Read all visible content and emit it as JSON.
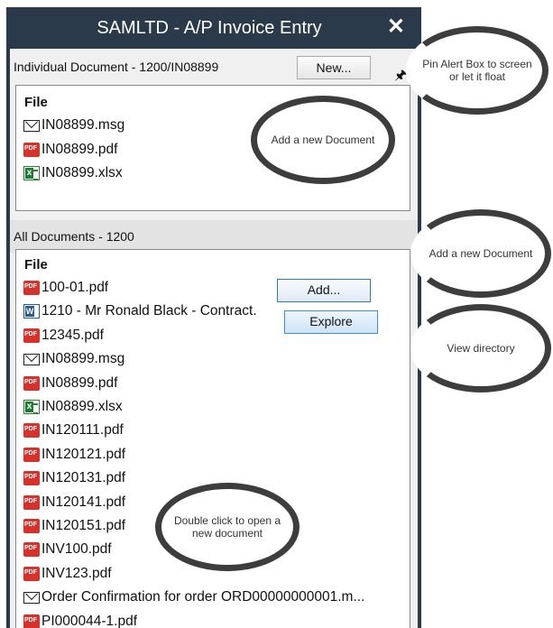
{
  "window": {
    "title": "SAMLTD - A/P Invoice Entry",
    "close_glyph": "✕"
  },
  "individual": {
    "header": "Individual Document - 1200/IN08899",
    "new_label": "New...",
    "pin_glyph": "🖈",
    "column": "File",
    "files": [
      {
        "name": "IN08899.msg",
        "icon": "msg"
      },
      {
        "name": "IN08899.pdf",
        "icon": "pdf"
      },
      {
        "name": "IN08899.xlsx",
        "icon": "xlsx"
      }
    ]
  },
  "all": {
    "header": "All Documents - 1200",
    "column": "File",
    "add_label": "Add...",
    "explore_label": "Explore",
    "files": [
      {
        "name": "100-01.pdf",
        "icon": "pdf"
      },
      {
        "name": "1210 - Mr Ronald Black - Contract.",
        "icon": "docx"
      },
      {
        "name": "12345.pdf",
        "icon": "pdf"
      },
      {
        "name": "IN08899.msg",
        "icon": "msg"
      },
      {
        "name": "IN08899.pdf",
        "icon": "pdf"
      },
      {
        "name": "IN08899.xlsx",
        "icon": "xlsx"
      },
      {
        "name": "IN120111.pdf",
        "icon": "pdf"
      },
      {
        "name": "IN120121.pdf",
        "icon": "pdf"
      },
      {
        "name": "IN120131.pdf",
        "icon": "pdf"
      },
      {
        "name": "IN120141.pdf",
        "icon": "pdf"
      },
      {
        "name": "IN120151.pdf",
        "icon": "pdf"
      },
      {
        "name": "INV100.pdf",
        "icon": "pdf"
      },
      {
        "name": "INV123.pdf",
        "icon": "pdf"
      },
      {
        "name": "Order Confirmation for order ORD00000000001.m...",
        "icon": "msg"
      },
      {
        "name": "PI000044-1.pdf",
        "icon": "pdf"
      }
    ]
  },
  "callouts": {
    "pin": "Pin Alert Box to screen or let it float",
    "add_new_1": "Add a new Document",
    "add_new_2": "Add a new Document",
    "view_directory": "View directory",
    "double_click": "Double click to open a new document"
  },
  "colors": {
    "titlebar": "#2b3a4a",
    "button_border": "#2f77c9",
    "pdf_red": "#d6322b",
    "excel_green": "#1e7b34",
    "word_blue": "#2b579a"
  }
}
